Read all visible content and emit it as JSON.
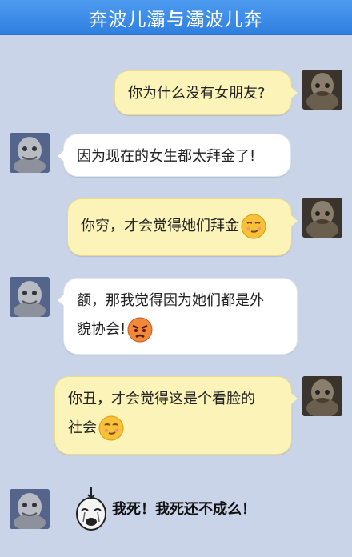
{
  "title": {
    "left": "奔波儿灞",
    "mid": "与",
    "right": "灞波儿奔"
  },
  "messages": [
    {
      "from": "right",
      "text": "你为什么没有女朋友?"
    },
    {
      "from": "left",
      "text": "因为现在的女生都太拜金了!"
    },
    {
      "from": "right",
      "text": "你穷，才会觉得她们拜金",
      "emoji": "smirk-emoji"
    },
    {
      "from": "left",
      "line1": "额，那我觉得因为她们都是外",
      "line2": "貌协会!",
      "emoji": "angry-emoji"
    },
    {
      "from": "right",
      "line1": "你丑，才会觉得这是个看脸的",
      "line2": "社会",
      "emoji": "smirk-emoji"
    },
    {
      "from": "left",
      "sticker": "crying-meme-sticker",
      "text": "我死！我死还不成么！"
    }
  ],
  "colors": {
    "background": "#c9d4e8",
    "title_bar": "#3a8ae8",
    "bubble_me": "#fbf3b8",
    "bubble_them": "#ffffff"
  }
}
